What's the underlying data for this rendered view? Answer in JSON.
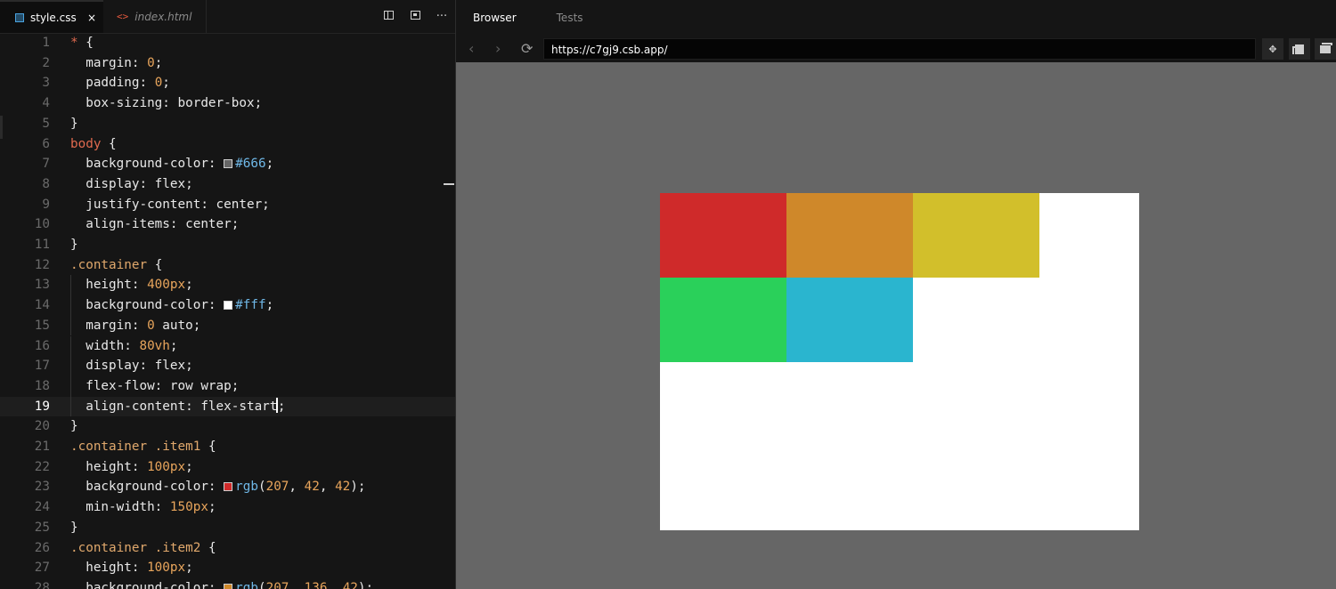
{
  "editor": {
    "tabs": [
      {
        "label": "style.css",
        "close": "×",
        "active": true
      },
      {
        "label": "index.html",
        "active": false
      }
    ],
    "actions": [
      "split-editor",
      "open-preview",
      "more"
    ],
    "more_label": "···",
    "active_line": 19
  },
  "code_lines": [
    {
      "n": "1",
      "t": "* {"
    },
    {
      "n": "2",
      "t": "  margin: 0;"
    },
    {
      "n": "3",
      "t": "  padding: 0;"
    },
    {
      "n": "4",
      "t": "  box-sizing: border-box;"
    },
    {
      "n": "5",
      "t": "}"
    },
    {
      "n": "6",
      "t": "body {"
    },
    {
      "n": "7",
      "t": "  background-color: #666;"
    },
    {
      "n": "8",
      "t": "  display: flex;"
    },
    {
      "n": "9",
      "t": "  justify-content: center;"
    },
    {
      "n": "10",
      "t": "  align-items: center;"
    },
    {
      "n": "11",
      "t": "}"
    },
    {
      "n": "12",
      "t": ".container {"
    },
    {
      "n": "13",
      "t": "  height: 400px;"
    },
    {
      "n": "14",
      "t": "  background-color: #fff;"
    },
    {
      "n": "15",
      "t": "  margin: 0 auto;"
    },
    {
      "n": "16",
      "t": "  width: 80vh;"
    },
    {
      "n": "17",
      "t": "  display: flex;"
    },
    {
      "n": "18",
      "t": "  flex-flow: row wrap;"
    },
    {
      "n": "19",
      "t": "  align-content: flex-start;"
    },
    {
      "n": "20",
      "t": "}"
    },
    {
      "n": "21",
      "t": ".container .item1 {"
    },
    {
      "n": "22",
      "t": "  height: 100px;"
    },
    {
      "n": "23",
      "t": "  background-color: rgb(207, 42, 42);"
    },
    {
      "n": "24",
      "t": "  min-width: 150px;"
    },
    {
      "n": "25",
      "t": "}"
    },
    {
      "n": "26",
      "t": ".container .item2 {"
    },
    {
      "n": "27",
      "t": "  height: 100px;"
    },
    {
      "n": "28",
      "t": "  background-color: rgb(207, 136, 42);"
    }
  ],
  "preview": {
    "tabs": [
      {
        "label": "Browser",
        "active": true
      },
      {
        "label": "Tests",
        "active": false
      }
    ],
    "url": "https://c7gj9.csb.app/",
    "page_background": "#666666",
    "container_background": "#ffffff",
    "items": [
      {
        "name": "item1",
        "color": "#cf2a2a"
      },
      {
        "name": "item2",
        "color": "#cf882a"
      },
      {
        "name": "item3",
        "color": "#d2bf2b"
      },
      {
        "name": "item4",
        "color": "#2ad05a"
      },
      {
        "name": "item5",
        "color": "#2ab5cf"
      }
    ]
  }
}
